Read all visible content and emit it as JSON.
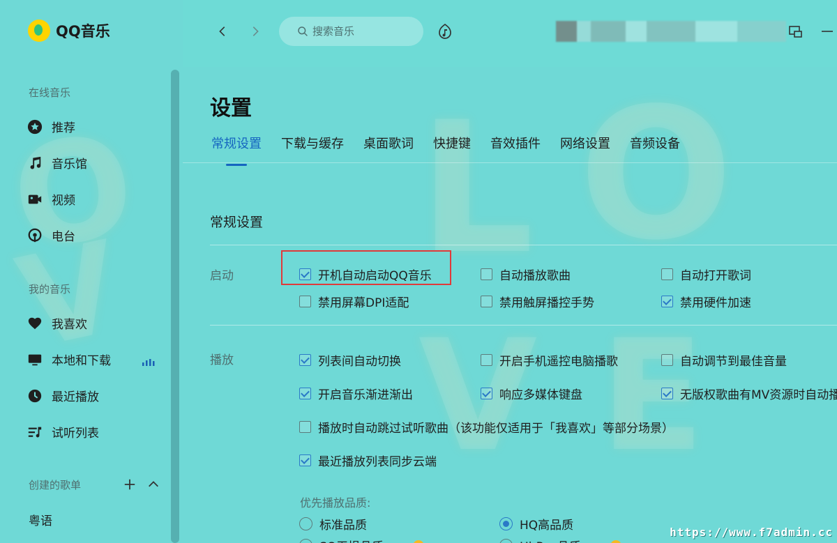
{
  "app": {
    "name": "QQ音乐"
  },
  "sidebar": {
    "group_online": "在线音乐",
    "online_items": [
      {
        "label": "推荐",
        "icon": "star-icon"
      },
      {
        "label": "音乐馆",
        "icon": "music-note-icon"
      },
      {
        "label": "视频",
        "icon": "video-icon"
      },
      {
        "label": "电台",
        "icon": "radio-icon"
      }
    ],
    "group_my": "我的音乐",
    "my_items": [
      {
        "label": "我喜欢",
        "icon": "heart-icon"
      },
      {
        "label": "本地和下载",
        "icon": "monitor-icon"
      },
      {
        "label": "最近播放",
        "icon": "clock-icon"
      },
      {
        "label": "试听列表",
        "icon": "playlist-icon"
      }
    ],
    "group_playlists": "创建的歌单",
    "playlists": [
      "粤语"
    ]
  },
  "topbar": {
    "search_placeholder": "搜索音乐"
  },
  "settings": {
    "title": "设置",
    "tabs": [
      "常规设置",
      "下载与缓存",
      "桌面歌词",
      "快捷键",
      "音效插件",
      "网络设置",
      "音频设备"
    ],
    "active_tab": "常规设置",
    "section_title": "常规设置",
    "startup": {
      "label": "启动",
      "options": [
        {
          "label": "开机自动启动QQ音乐",
          "checked": true
        },
        {
          "label": "自动播放歌曲",
          "checked": false
        },
        {
          "label": "自动打开歌词",
          "checked": false
        },
        {
          "label": "禁用屏幕DPI适配",
          "checked": false
        },
        {
          "label": "禁用触屏播控手势",
          "checked": false
        },
        {
          "label": "禁用硬件加速",
          "checked": true
        }
      ]
    },
    "playback": {
      "label": "播放",
      "options": [
        {
          "label": "列表间自动切换",
          "checked": true
        },
        {
          "label": "开启手机遥控电脑播歌",
          "checked": false
        },
        {
          "label": "自动调节到最佳音量",
          "checked": false
        },
        {
          "label": "开启音乐渐进渐出",
          "checked": true
        },
        {
          "label": "响应多媒体键盘",
          "checked": true
        },
        {
          "label": "无版权歌曲有MV资源时自动播",
          "checked": true
        },
        {
          "label": "播放时自动跳过试听歌曲（该功能仅适用于「我喜欢」等部分场景）",
          "checked": false
        },
        {
          "label": "最近播放列表同步云端",
          "checked": true
        }
      ],
      "quality_label": "优先播放品质:",
      "quality_options": [
        {
          "label": "标准品质",
          "selected": false
        },
        {
          "label": "HQ高品质",
          "selected": true
        },
        {
          "label": "SQ无损品质",
          "selected": false
        },
        {
          "label": "Hi-Res品质",
          "selected": false
        }
      ]
    }
  },
  "watermark": "https://www.f7admin.cc",
  "colors": {
    "accent": "#1565c0",
    "highlight": "#e03a3a",
    "background": "#6fd9d6"
  }
}
